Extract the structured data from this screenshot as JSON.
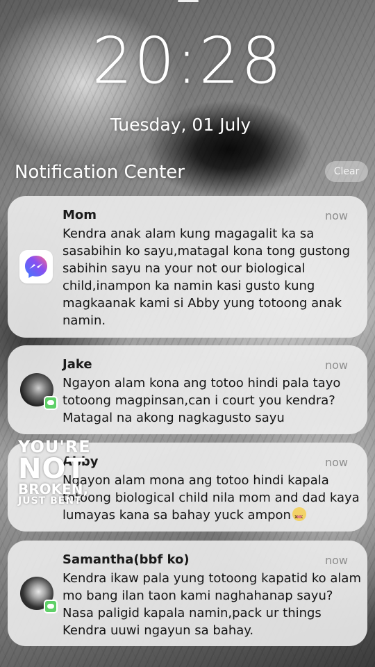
{
  "lockscreen": {
    "time": "20:28",
    "date": "Tuesday, 01 July"
  },
  "notification_center": {
    "title": "Notification Center",
    "clear_label": "Clear"
  },
  "notifications": [
    {
      "sender": "Mom",
      "time": "now",
      "icon": "messenger-icon",
      "body": "Kendra anak alam kung magagalit ka sa sasabihin ko sayu,matagal kona tong gustong sabihin sayu na your not our biological child,inampon ka namin kasi  gusto kung magkaanak kami si Abby yung totoong anak namin."
    },
    {
      "sender": "Jake",
      "time": "now",
      "icon": "avatar",
      "body": "Ngayon alam kona ang totoo hindi pala tayo totoong magpinsan,can i court you kendra? Matagal na akong nagkagusto sayu"
    },
    {
      "sender": "Abby",
      "time": "now",
      "icon": "avatar",
      "body": "Ngayon alam mona ang totoo hindi kapala totoong biological child nila mom and dad kaya lumayas kana sa bahay yuck ampon"
    },
    {
      "sender": "Samantha(bbf ko)",
      "time": "now",
      "icon": "avatar",
      "body": "Kendra ikaw pala yung totoong kapatid ko alam mo bang ilan taon kami naghahanap sayu?Nasa paligid kapala namin,pack ur things Kendra uuwi ngayun sa bahay."
    }
  ],
  "overlay": {
    "line1": "YOU'RE",
    "line2": "NOT",
    "line3": "BROKEN,",
    "line4": "JUST BENT"
  },
  "colors": {
    "card_bg": "#ececec",
    "messenger_gradient_start": "#7a5cf0",
    "messenger_gradient_end": "#2f6bff",
    "imessage_green": "#5fd068"
  }
}
